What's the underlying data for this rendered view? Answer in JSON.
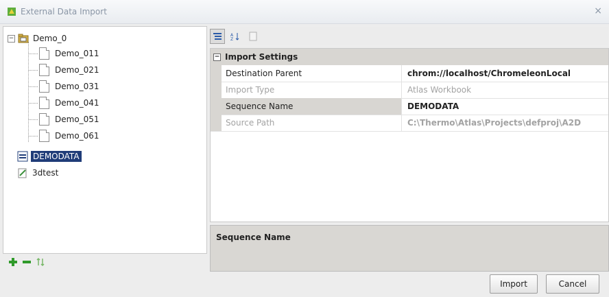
{
  "window": {
    "title": "External Data Import",
    "close_glyph": "×"
  },
  "tree": {
    "root": {
      "label": "Demo_0",
      "expander": "−"
    },
    "children": [
      "Demo_011",
      "Demo_021",
      "Demo_031",
      "Demo_041",
      "Demo_051",
      "Demo_061"
    ],
    "selected": {
      "label": "DEMODATA"
    },
    "other": {
      "label": "3dtest"
    }
  },
  "left_toolbar": {
    "icons": [
      "add-icon",
      "remove-icon",
      "sort-icon"
    ]
  },
  "right_toolbar": {
    "icons": [
      "categorized-icon",
      "alphabetical-sort-icon",
      "property-pages-icon"
    ]
  },
  "grid": {
    "category": {
      "label": "Import Settings",
      "toggle": "−"
    },
    "rows": [
      {
        "name": "Destination Parent",
        "value": "chrom://localhost/ChromeleonLocal"
      },
      {
        "name": "Import Type",
        "value": "Atlas Workbook"
      },
      {
        "name": "Sequence Name",
        "value": "DEMODATA"
      },
      {
        "name": "Source Path",
        "value": "C:\\Thermo\\Atlas\\Projects\\defproj\\A2D"
      }
    ]
  },
  "description": {
    "title": "Sequence Name"
  },
  "buttons": {
    "import": "Import",
    "cancel": "Cancel"
  },
  "colors": {
    "selection": "#1f3c78",
    "accent_green": "#2f9a2a"
  }
}
